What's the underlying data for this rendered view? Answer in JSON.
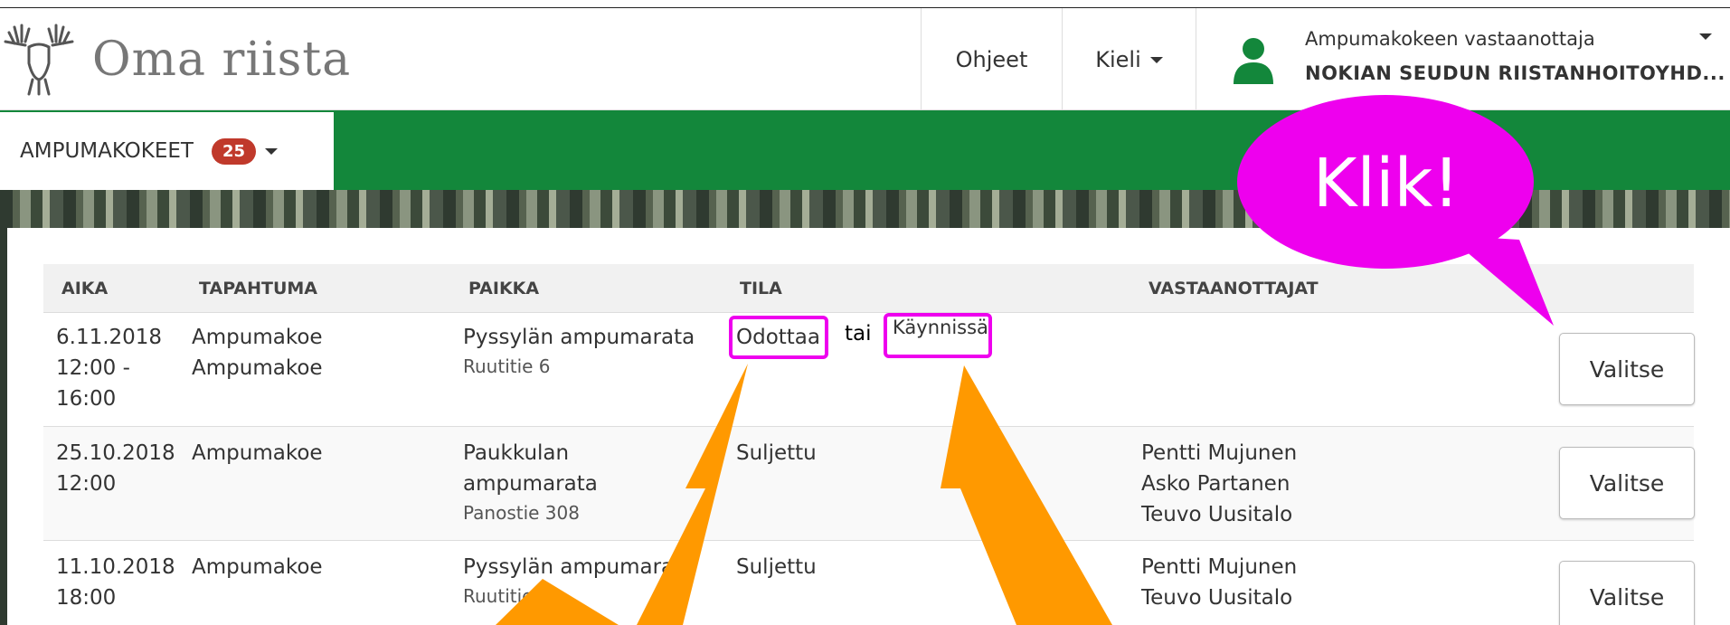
{
  "header": {
    "app_name": "Oma riista",
    "nav_help": "Ohjeet",
    "nav_language": "Kieli",
    "user_role": "Ampumakokeen vastaanottaja",
    "user_org": "NOKIAN SEUDUN RIISTANHOITOYHD..."
  },
  "menu": {
    "label": "AMPUMAKOKEET",
    "badge": "25"
  },
  "table": {
    "headers": {
      "aika": "AIKA",
      "tapahtuma": "TAPAHTUMA",
      "paikka": "PAIKKA",
      "tila": "TILA",
      "vastaanottajat": "VASTAANOTTAJAT"
    },
    "rows": [
      {
        "date": "6.11.2018",
        "time1": "12:00 -",
        "time2": "16:00",
        "event1": "Ampumakoe",
        "event2": "Ampumakoe",
        "place": "Pyssylän ampumarata",
        "address": "Ruutitie 6",
        "status": "Odottaa",
        "button": "Valitse"
      },
      {
        "date": "25.10.2018",
        "time1": "12:00",
        "event1": "Ampumakoe",
        "place1": "Paukkulan",
        "place2": "ampumarata",
        "address": "Panostie 308",
        "status": "Suljettu",
        "officials": [
          "Pentti Mujunen",
          "Asko Partanen",
          "Teuvo Uusitalo"
        ],
        "button": "Valitse"
      },
      {
        "date": "11.10.2018",
        "time1": "18:00",
        "event1": "Ampumakoe",
        "place": "Pyssylän ampumarata",
        "address": "Ruutitie 6",
        "status": "Suljettu",
        "officials": [
          "Pentti Mujunen",
          "Teuvo Uusitalo"
        ],
        "button": "Valitse"
      }
    ]
  },
  "annotations": {
    "or_text": "tai",
    "alt_status": "Käynnissä",
    "bubble_text": "Klik!",
    "highlight_color": "#ee00ee",
    "arrow_color": "#ff9900"
  },
  "colors": {
    "brand_green": "#13873b",
    "badge_red": "#c0392b"
  }
}
